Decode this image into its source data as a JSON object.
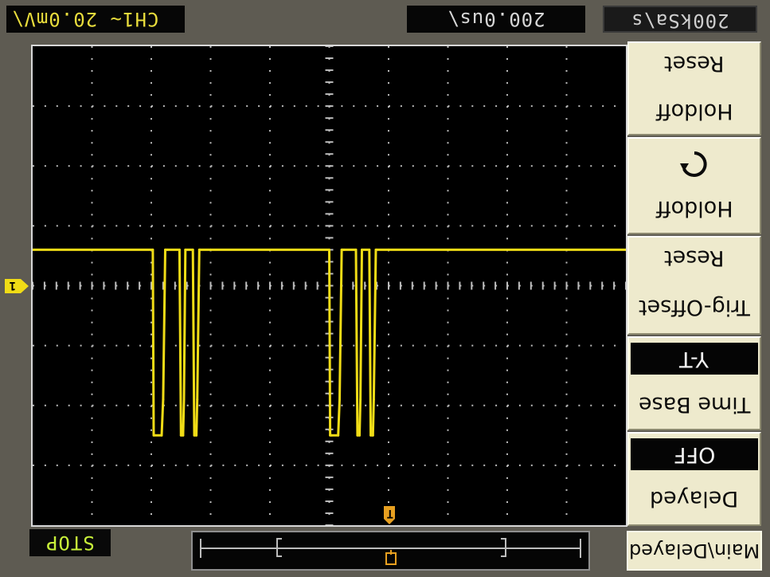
{
  "header": {
    "ch1_scale": "CH1~ 20.0mV\\",
    "timebase": "200.0us\\",
    "sample_rate": "200kSa\\s"
  },
  "status": {
    "run_state": "STOP"
  },
  "markers": {
    "channel_marker": "1",
    "trigger_marker": "T"
  },
  "menu": {
    "items": [
      {
        "title": "Reset",
        "value": "Holdoff"
      },
      {
        "title": "Holdoff",
        "icon": "rotate-knob-icon"
      },
      {
        "title": "Reset",
        "value": "Trig-Offset"
      },
      {
        "title": "Y-T",
        "value": "Time Base"
      },
      {
        "title": "OFF",
        "value": "Delayed"
      }
    ],
    "bottom_label": "Main\\Delayed"
  },
  "colors": {
    "trace": "#f0dc16",
    "grid_dots": "#bcbcbc",
    "trigger": "#e8a020",
    "panel": "#eeeacd",
    "bezel": "#5e5b52"
  },
  "chart_data": {
    "type": "line",
    "title": "",
    "xlabel": "",
    "ylabel": "",
    "x_divisions": 10,
    "y_divisions": 8,
    "xlim": [
      -1000,
      1000
    ],
    "ylim": [
      -80,
      80
    ],
    "x_units": "us",
    "y_units": "mV",
    "series": [
      {
        "x": [
          -1000,
          -595,
          -592,
          -565,
          -560,
          -553,
          -550,
          -545,
          -505,
          -500,
          -493,
          -490,
          -485,
          -460,
          -455,
          -448,
          -445,
          -438,
          -435,
          -400,
          0,
          3,
          8,
          30,
          35,
          42,
          45,
          50,
          90,
          95,
          102,
          105,
          110,
          135,
          140,
          147,
          150,
          157,
          160,
          200,
          1000
        ],
        "y": [
          12,
          12,
          -50,
          -50,
          -38,
          12,
          12,
          12,
          12,
          -50,
          -50,
          -38,
          12,
          12,
          -50,
          -50,
          -38,
          12,
          12,
          12,
          12,
          -50,
          -50,
          -50,
          -38,
          12,
          12,
          12,
          12,
          -50,
          -50,
          -38,
          12,
          12,
          -50,
          -50,
          -38,
          12,
          12,
          12,
          12
        ]
      }
    ]
  }
}
